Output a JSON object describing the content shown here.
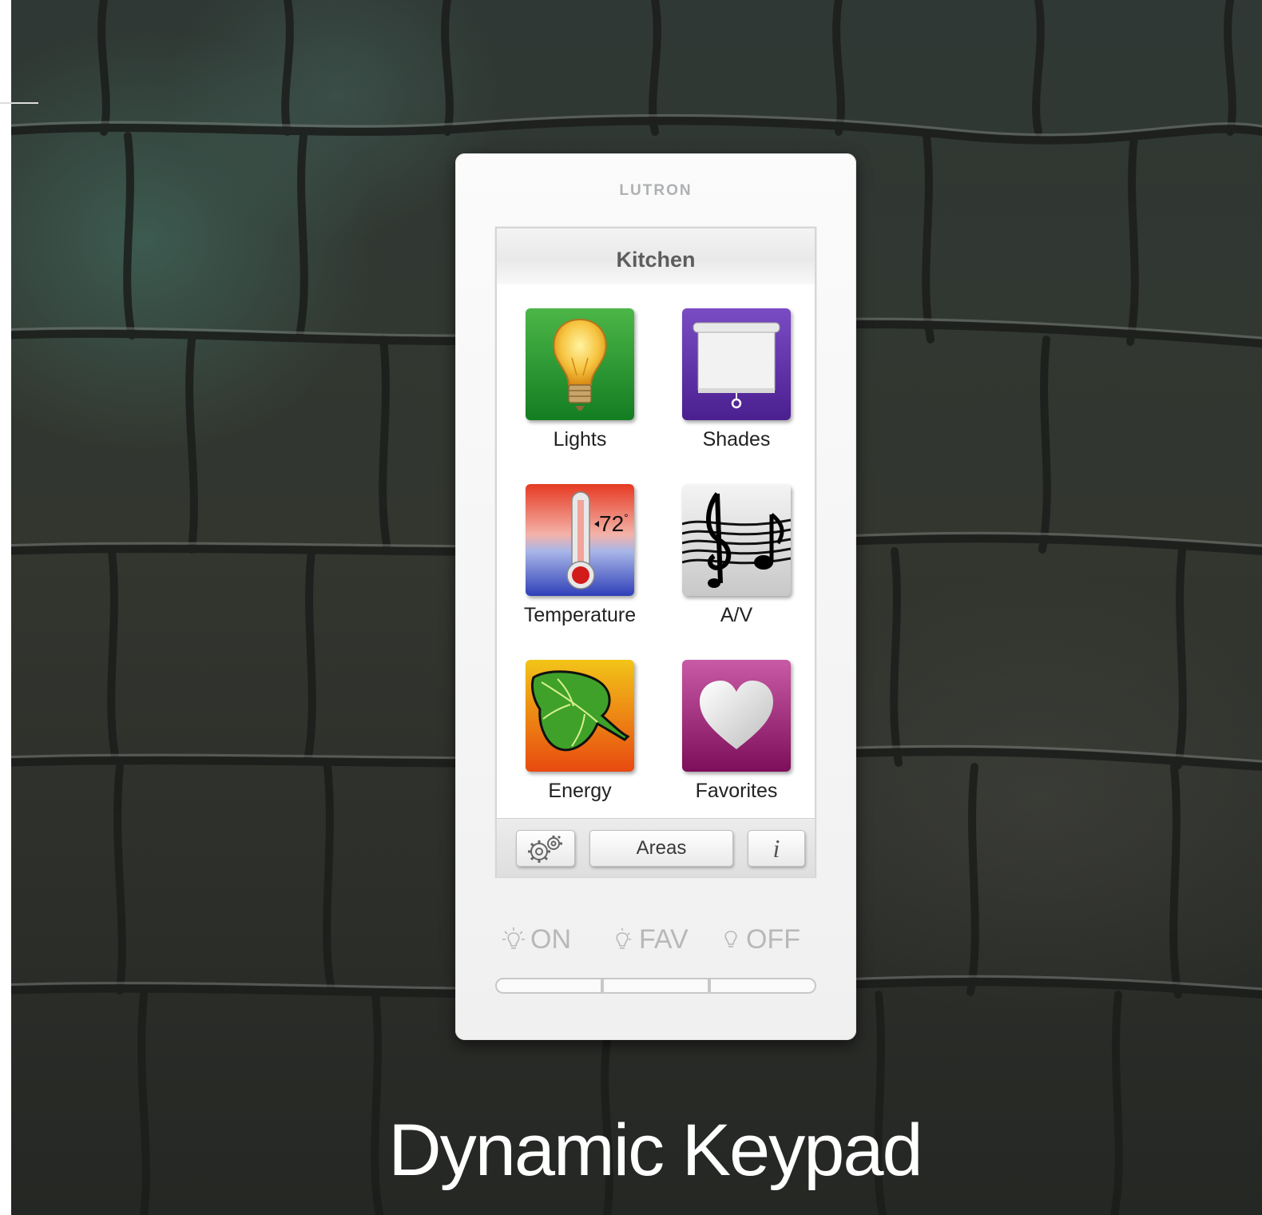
{
  "brand": "LUTRON",
  "screen": {
    "title": "Kitchen",
    "tiles": [
      {
        "label": "Lights",
        "icon": "light-bulb-icon"
      },
      {
        "label": "Shades",
        "icon": "shade-icon"
      },
      {
        "label": "Temperature",
        "icon": "thermometer-icon",
        "reading": "72",
        "unit": "°"
      },
      {
        "label": "A/V",
        "icon": "music-notes-icon"
      },
      {
        "label": "Energy",
        "icon": "leaf-icon"
      },
      {
        "label": "Favorites",
        "icon": "heart-icon"
      }
    ],
    "toolbar": {
      "settings_icon": "gears-icon",
      "areas_label": "Areas",
      "info_label": "i"
    }
  },
  "hardware_buttons": [
    {
      "label": "ON",
      "icon": "light-on-icon"
    },
    {
      "label": "FAV",
      "icon": "light-fav-icon"
    },
    {
      "label": "OFF",
      "icon": "light-off-icon"
    }
  ],
  "caption": "Dynamic Keypad",
  "colors": {
    "lights_tile": "#1f8a2a",
    "shades_tile": "#5a2fa0",
    "energy_tile": "#f08a10",
    "favorites_tile": "#a3176f",
    "hardware_label": "#b8b8b8"
  }
}
